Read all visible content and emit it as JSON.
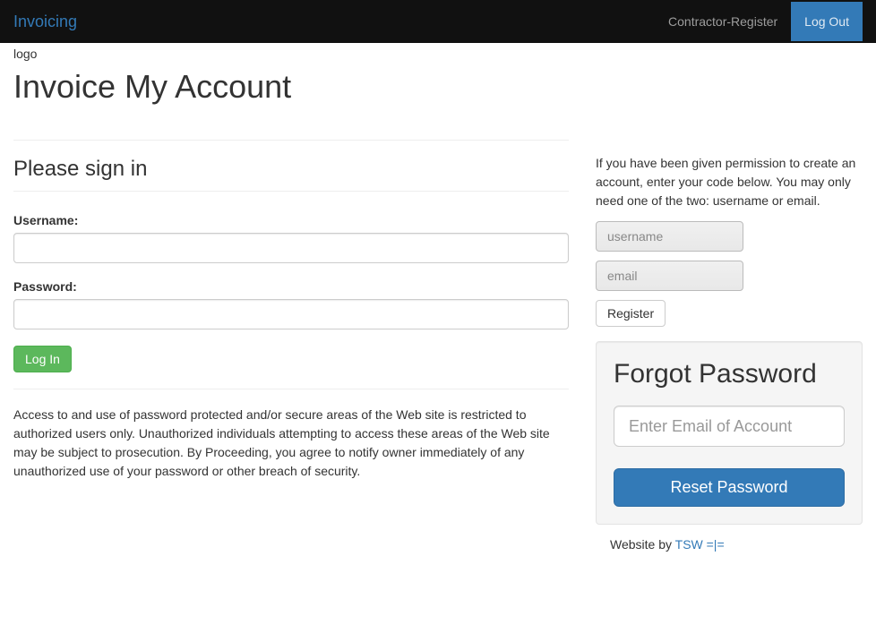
{
  "navbar": {
    "brand": "Invoicing",
    "contractor_register": "Contractor-Register",
    "logout": "Log Out"
  },
  "logo_text": "logo",
  "page_title": "Invoice My Account",
  "signin": {
    "title": "Please sign in",
    "username_label": "Username:",
    "password_label": "Password:",
    "button": "Log In"
  },
  "disclaimer": "Access to and use of password protected and/or secure areas of the Web site is restricted to authorized users only. Unauthorized individuals attempting to access these areas of the Web site may be subject to prosecution. By Proceeding, you agree to notify owner immediately of any unauthorized use of your password or other breach of security.",
  "create_account": {
    "intro": "If you have been given permission to create an account, enter your code below. You may only need one of the two: username or email.",
    "username_placeholder": "username",
    "email_placeholder": "email",
    "register_button": "Register"
  },
  "forgot": {
    "title": "Forgot Password",
    "email_placeholder": "Enter Email of Account",
    "button": "Reset Password"
  },
  "footer": {
    "prefix": "Website by ",
    "link_text": "TSW =|="
  }
}
